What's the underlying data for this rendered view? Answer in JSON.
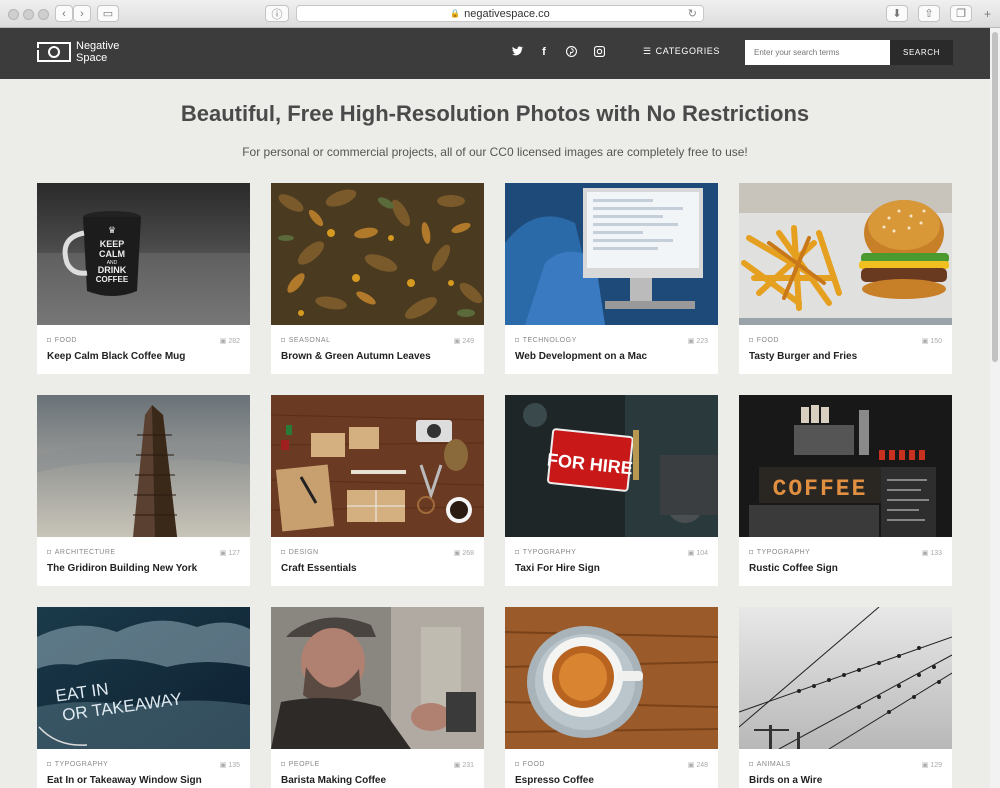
{
  "browser": {
    "url": "negativespace.co"
  },
  "header": {
    "logo_line1": "Negative",
    "logo_line2": "Space",
    "categories_label": "CATEGORIES",
    "search_placeholder": "Enter your search terms",
    "search_button": "SEARCH"
  },
  "hero": {
    "title": "Beautiful, Free High-Resolution Photos with No Restrictions",
    "subtitle": "For personal or commercial projects, all of our CC0 licensed images are completely free to use!"
  },
  "cards": [
    {
      "category": "FOOD",
      "count": "282",
      "title": "Keep Calm Black Coffee Mug"
    },
    {
      "category": "SEASONAL",
      "count": "249",
      "title": "Brown & Green Autumn Leaves"
    },
    {
      "category": "TECHNOLOGY",
      "count": "223",
      "title": "Web Development on a Mac"
    },
    {
      "category": "FOOD",
      "count": "150",
      "title": "Tasty Burger and Fries"
    },
    {
      "category": "ARCHITECTURE",
      "count": "127",
      "title": "The Gridiron Building New York"
    },
    {
      "category": "DESIGN",
      "count": "268",
      "title": "Craft Essentials"
    },
    {
      "category": "TYPOGRAPHY",
      "count": "104",
      "title": "Taxi For Hire Sign"
    },
    {
      "category": "TYPOGRAPHY",
      "count": "133",
      "title": "Rustic Coffee Sign"
    },
    {
      "category": "TYPOGRAPHY",
      "count": "135",
      "title": "Eat In or Takeaway Window Sign"
    },
    {
      "category": "PEOPLE",
      "count": "231",
      "title": "Barista Making Coffee"
    },
    {
      "category": "FOOD",
      "count": "248",
      "title": "Espresso Coffee"
    },
    {
      "category": "ANIMALS",
      "count": "129",
      "title": "Birds on a Wire"
    }
  ],
  "image_text": {
    "mug": [
      "KEEP",
      "CALM",
      "AND",
      "DRINK",
      "COFFEE"
    ],
    "for_hire": "FOR HIRE",
    "coffee_sign": "COFFEE",
    "eat_in": "EAT IN",
    "takeaway": "OR TAKEAWAY"
  },
  "colors": {
    "header_bg": "#3c3c3c",
    "page_bg": "#ecece8",
    "search_button_bg": "#2a2a2a"
  }
}
